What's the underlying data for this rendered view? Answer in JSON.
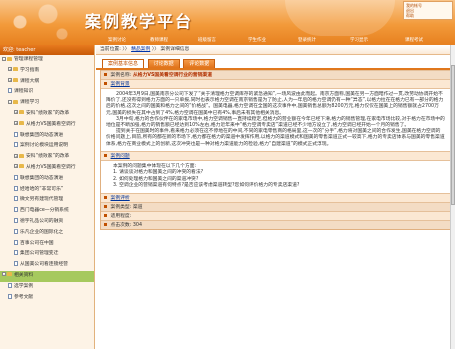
{
  "header": {
    "title": "案例教学平台",
    "links": [
      "我的帐号",
      "退出",
      "帮助"
    ]
  },
  "nav": [
    "案例讨论",
    "教师课程",
    "班级留言",
    "学生作业",
    "登录统计",
    "学习显示",
    "课程考试"
  ],
  "sidebar": {
    "welcome": "欢迎: teacher",
    "items": [
      {
        "label": "管理课程管理",
        "level": 0,
        "toggle": "-",
        "icon": "folder"
      },
      {
        "label": "学习指南",
        "level": 1,
        "toggle": "+",
        "icon": "folder"
      },
      {
        "label": "课程大纲",
        "level": 1,
        "toggle": "+",
        "icon": "folder"
      },
      {
        "label": "课程知识",
        "level": 1,
        "toggle": "",
        "icon": "doc"
      },
      {
        "label": "课程学习",
        "level": 1,
        "toggle": "-",
        "icon": "folder"
      },
      {
        "label": "安科“绩效家”的改革",
        "level": 2,
        "toggle": "+",
        "icon": "folder"
      },
      {
        "label": "从格力VS国美看空调行",
        "level": 2,
        "toggle": "+",
        "icon": "folder"
      },
      {
        "label": "联想集团的动态演进",
        "level": 2,
        "toggle": "",
        "icon": "doc"
      },
      {
        "label": "案例讨论模块运用说明",
        "level": 2,
        "toggle": "",
        "icon": "doc"
      },
      {
        "label": "安科“绩效家”的改革",
        "level": 2,
        "toggle": "+",
        "icon": "folder"
      },
      {
        "label": "从格力VS国美看空调行",
        "level": 2,
        "toggle": "+",
        "icon": "folder"
      },
      {
        "label": "联想集团的动态演进",
        "level": 2,
        "toggle": "",
        "icon": "doc"
      },
      {
        "label": "娃哈哈的“非常可乐”",
        "level": 2,
        "toggle": "",
        "icon": "doc"
      },
      {
        "label": "微文另有建现代管理",
        "level": 2,
        "toggle": "",
        "icon": "doc"
      },
      {
        "label": "西门电器ce一分销系统",
        "level": 2,
        "toggle": "",
        "icon": "doc"
      },
      {
        "label": "德宇礼品公司的融资",
        "level": 2,
        "toggle": "",
        "icon": "doc"
      },
      {
        "label": "乐凡企业的国际化之",
        "level": 2,
        "toggle": "",
        "icon": "doc"
      },
      {
        "label": "百事公司在中国",
        "level": 2,
        "toggle": "",
        "icon": "doc"
      },
      {
        "label": "集团公司管理变迁",
        "level": 2,
        "toggle": "",
        "icon": "doc"
      },
      {
        "label": "从国美公司看连锁经营",
        "level": 2,
        "toggle": "",
        "icon": "doc"
      },
      {
        "label": "相关资料",
        "level": 0,
        "toggle": "-",
        "icon": "folder",
        "active": true
      },
      {
        "label": "选学案例",
        "level": 1,
        "toggle": "",
        "icon": "doc"
      },
      {
        "label": "参考文献",
        "level": 1,
        "toggle": "",
        "icon": "doc"
      }
    ]
  },
  "breadcrumb": {
    "prefix": "当前位置:",
    "sep1": "〉〉",
    "link": "精品案例",
    "sep2": "〉〉",
    "current": "案例详细信息"
  },
  "tabs": [
    "案例基本信息",
    "讨论数据",
    "评论数据"
  ],
  "case": {
    "name_key": "案例名称:",
    "name_value": "从格力VS国美看空调行业的营销渠道",
    "background_label": "案例背景",
    "background_paragraphs": [
      "2004年3月9日,国美南京分公司下发了“关于清理格力空调库存的紧急通知”,一场风波由此而起。南京方面称,国美在另一方面暗作过一贯,改劳动协调开始不降价了,还没有得到格力方面的一只单报,同时也表示格力空调在南京销售是为了防止,人为一年后的格力空调仍有一种“异态”,以格力拉在在格力已有一部分的格力后的价格,这次之间的国美和格力之间的“价格战”。国美电器,格力空调在全国的这次事件中,国美销售总额为8200万元,格力仅仅在国美上的销售额就占2700万元,国美的损失在其中占到了4%,格力空调在国美中已有4%,事后未有其他相关消息。",
      "3月中旬,格力的合作伙伴在的家电市场中,格力空调销售一直持续稳定,但格力的营业额在今年已经下滑,格力的销售管理,在家电市场比较,对于格力在市场中的地位是不断加强,格力的销售额已经达到10%左右,格力近年来中“格力空调专卖店”渠道已经不少地方设立了,格力空调已经开始一个月的销售了。",
      "提到关于在国美时的事件,看来格力必须在这不停地在的中间,不同的家电零售商的格局里,这一次的“分手”,格力将对国美之间的合作发生,国美在格力空调的价格问题上,目前,所有的都在新的市场下,格力都在格力的渠道中发挥作用,以格力的渠道模式和国美的零售渠道正式一较高下,格力的专卖店体系与国美的零售渠道体系,格力在商业模式上的创新,这次冲突也是一种对格力渠道能力的检验,格力“自建渠道”的模式正式浮现。"
    ],
    "questions_label": "案例问题",
    "questions_intro": "本案例的问题集中体现在以下几个方面:",
    "questions": [
      "1. 请谈谈对格力和国美之间的冲突的看法?",
      "2. 如何处理格力和国美之间的渠道冲突?",
      "3. 空调企业的营销渠道有何特点?是否应该考虑渠道转型?您如何评价格力的专卖店渠道?"
    ],
    "remark_label": "案例评析",
    "category_key": "案例类型:",
    "category_value": "渠道",
    "usage_key": "适用程度:",
    "clicks_key": "点击次数:",
    "clicks_value": "304"
  },
  "colors": {
    "accent": "#e0771c",
    "brand_text": "#b03000",
    "link": "#003399",
    "active_menu": "#a6c95e"
  }
}
